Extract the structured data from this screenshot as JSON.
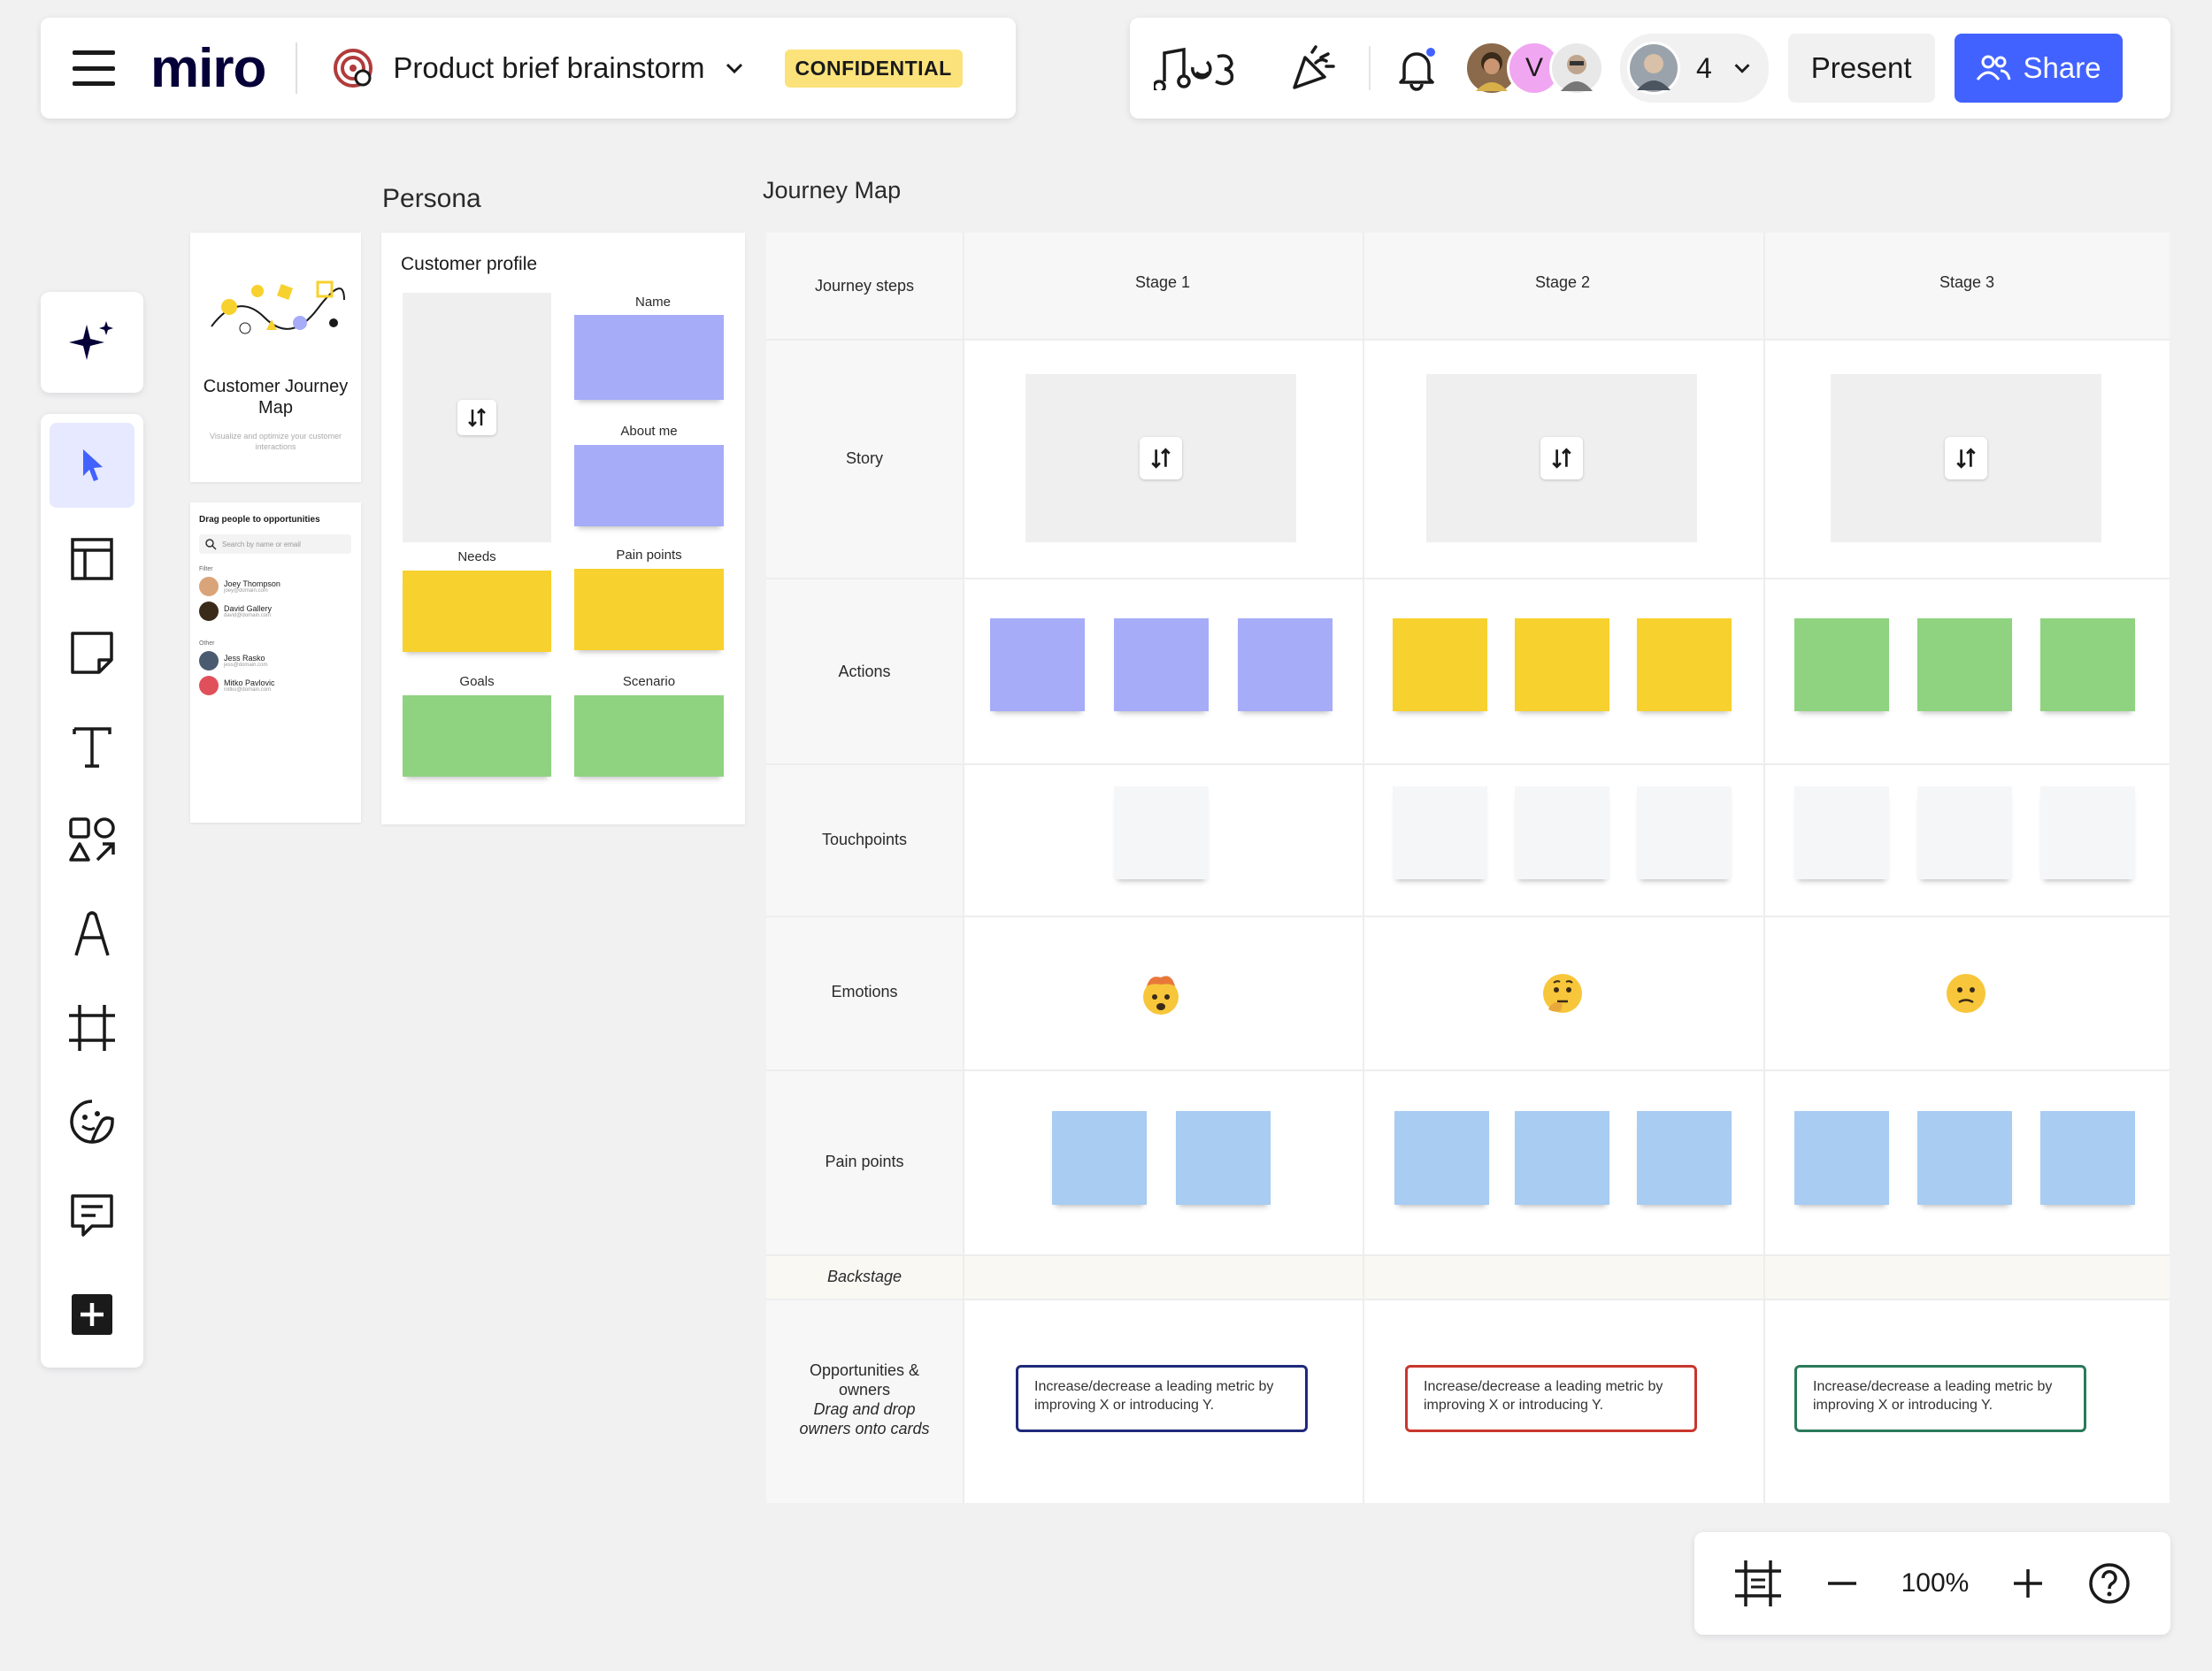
{
  "app": {
    "logo": "miro"
  },
  "board": {
    "title": "Product brief brainstorm",
    "badge": "CONFIDENTIAL"
  },
  "topbar": {
    "avatar_v_initial": "V",
    "collaborator_count": "4",
    "present_label": "Present",
    "share_label": "Share"
  },
  "toolbar": {
    "tools": [
      "ai-assist",
      "select",
      "templates",
      "sticky-note",
      "text",
      "shapes",
      "pen",
      "frame",
      "stickers",
      "comment",
      "more-apps"
    ]
  },
  "persona": {
    "label": "Persona",
    "cover_title": "Customer Journey Map",
    "cover_subtitle": "Visualize and optimize your customer interactions",
    "people_title": "Drag people to opportunities",
    "people_search_placeholder": "Search by name or email",
    "group_1": "Filter",
    "people_1": [
      {
        "name": "Joey Thompson",
        "email": "joey@domain.com"
      },
      {
        "name": "David Gallery",
        "email": "david@domain.com"
      }
    ],
    "group_2": "Other",
    "people_2": [
      {
        "name": "Jess Rasko",
        "email": "jess@domain.com"
      },
      {
        "name": "Mitko Pavlovic",
        "email": "mitko@domain.com"
      }
    ],
    "profile_title": "Customer profile",
    "field_name": "Name",
    "field_about": "About me",
    "field_needs": "Needs",
    "field_pain": "Pain points",
    "field_goals": "Goals",
    "field_scenario": "Scenario"
  },
  "journey": {
    "label": "Journey Map",
    "header_label": "Journey steps",
    "stages": [
      "Stage 1",
      "Stage 2",
      "Stage 3"
    ],
    "rows": {
      "story": "Story",
      "actions": "Actions",
      "touchpoints": "Touchpoints",
      "emotions": "Emotions",
      "pain_points": "Pain points",
      "backstage": "Backstage",
      "opportunities_line1": "Opportunities &",
      "opportunities_line2": "owners",
      "opportunities_hint1": "Drag and drop",
      "opportunities_hint2": "owners onto cards"
    },
    "opportunity_text": "Increase/decrease a leading metric by improving X or introducing Y.",
    "opportunity_colors": [
      "#1f2a7a",
      "#c8372d",
      "#2a7a5a"
    ],
    "emotion_icons": [
      "mind-blown-emoji-icon",
      "thinking-emoji-icon",
      "confused-emoji-icon"
    ]
  },
  "zoom": {
    "level": "100%"
  },
  "colors": {
    "accent": "#4262ff",
    "sticky_purple": "#a6acf7",
    "sticky_yellow": "#f7d12e",
    "sticky_green": "#8fd380",
    "sticky_blue": "#a8ccf2",
    "sticky_white": "#f5f6f8",
    "badge_yellow": "#fbe27a"
  }
}
